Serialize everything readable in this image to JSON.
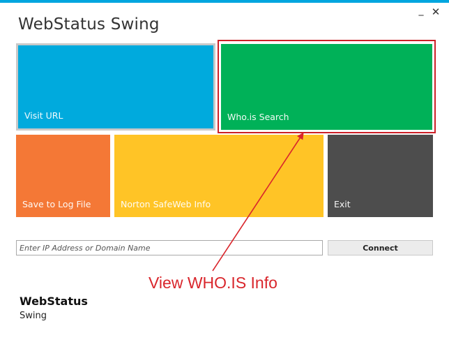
{
  "window": {
    "title": "WebStatus Swing",
    "minimize_glyph": "_",
    "close_glyph": "✕",
    "accent_color": "#00a6df"
  },
  "tiles": {
    "visit_url": {
      "label": "Visit URL",
      "color": "#00aadd"
    },
    "whois_search": {
      "label": "Who.is Search",
      "color": "#00b158"
    },
    "save_log": {
      "label": "Save to Log File",
      "color": "#f47836"
    },
    "norton": {
      "label": "Norton SafeWeb Info",
      "color": "#ffc426"
    },
    "exit": {
      "label": "Exit",
      "color": "#4d4d4d"
    }
  },
  "address_bar": {
    "placeholder": "Enter IP Address or Domain Name",
    "value": ""
  },
  "connect_button": {
    "label": "Connect"
  },
  "annotation": {
    "text": "View WHO.IS Info",
    "color": "#d9262c"
  },
  "footer": {
    "title": "WebStatus",
    "subtitle": "Swing"
  }
}
